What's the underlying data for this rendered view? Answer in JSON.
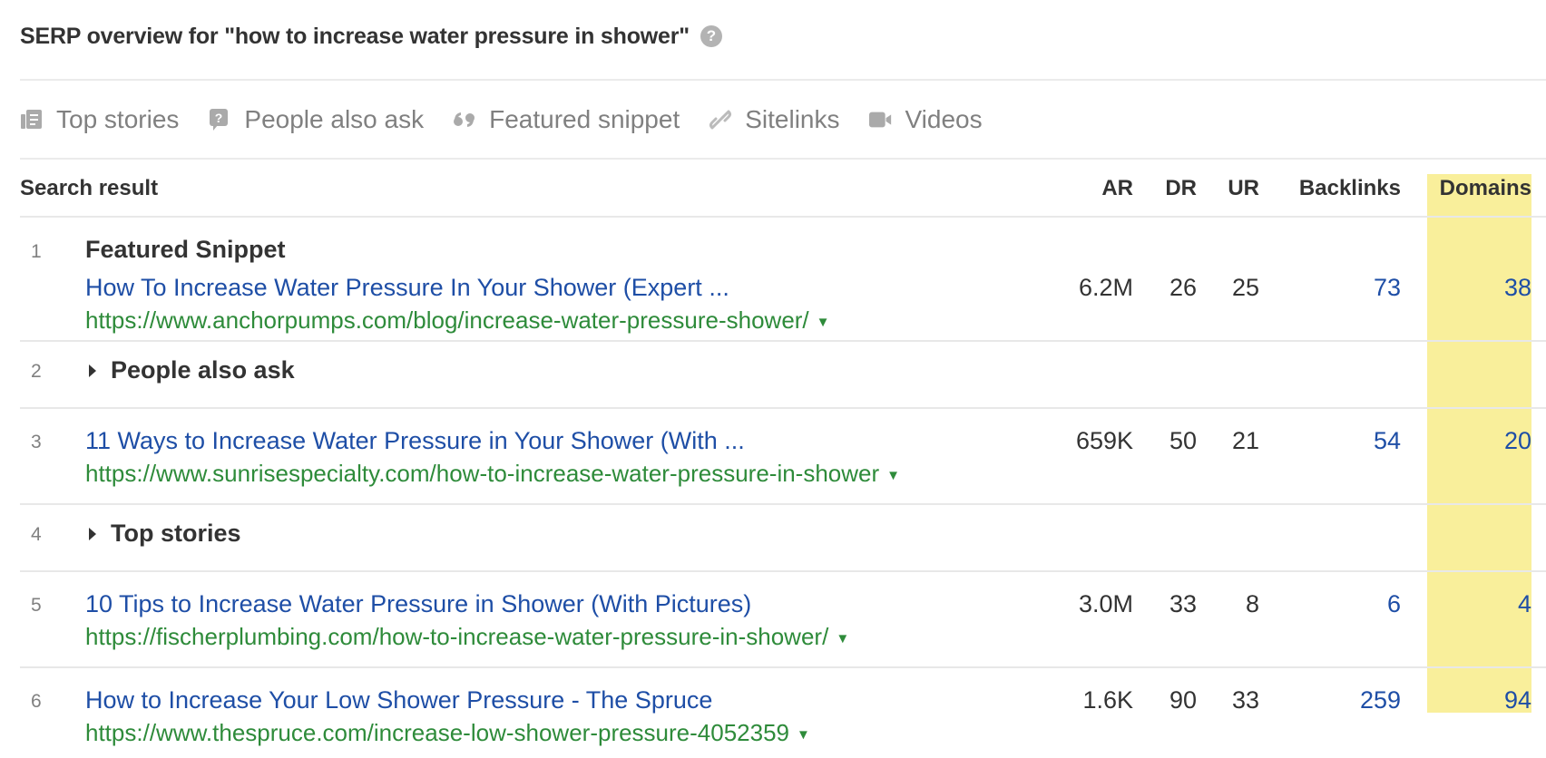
{
  "header": {
    "title": "SERP overview for \"how to increase water pressure in shower\"",
    "help_icon": "?"
  },
  "features": [
    {
      "icon": "newspaper-icon",
      "label": "Top stories"
    },
    {
      "icon": "question-bubble-icon",
      "label": "People also ask"
    },
    {
      "icon": "quote-icon",
      "label": "Featured snippet"
    },
    {
      "icon": "link-icon",
      "label": "Sitelinks"
    },
    {
      "icon": "video-camera-icon",
      "label": "Videos"
    }
  ],
  "table": {
    "columns": {
      "result": "Search result",
      "ar": "AR",
      "dr": "DR",
      "ur": "UR",
      "backlinks": "Backlinks",
      "domains": "Domains"
    },
    "highlight_color": "#f9ef9b",
    "rows": [
      {
        "num": "1",
        "kind": "Featured Snippet",
        "title": "How To Increase Water Pressure In Your Shower (Expert ...",
        "url": "https://www.anchorpumps.com/blog/increase-water-pressure-shower/",
        "ar": "6.2M",
        "dr": "26",
        "ur": "25",
        "backlinks": "73",
        "domains": "38"
      },
      {
        "num": "2",
        "expander": "People also ask"
      },
      {
        "num": "3",
        "title": "11 Ways to Increase Water Pressure in Your Shower (With ...",
        "url": "https://www.sunrisespecialty.com/how-to-increase-water-pressure-in-shower",
        "ar": "659K",
        "dr": "50",
        "ur": "21",
        "backlinks": "54",
        "domains": "20"
      },
      {
        "num": "4",
        "expander": "Top stories"
      },
      {
        "num": "5",
        "title": "10 Tips to Increase Water Pressure in Shower (With Pictures)",
        "url": "https://fischerplumbing.com/how-to-increase-water-pressure-in-shower/",
        "ar": "3.0M",
        "dr": "33",
        "ur": "8",
        "backlinks": "6",
        "domains": "4"
      },
      {
        "num": "6",
        "title": "How to Increase Your Low Shower Pressure - The Spruce",
        "url": "https://www.thespruce.com/increase-low-shower-pressure-4052359",
        "ar": "1.6K",
        "dr": "90",
        "ur": "33",
        "backlinks": "259",
        "domains": "94"
      }
    ]
  }
}
